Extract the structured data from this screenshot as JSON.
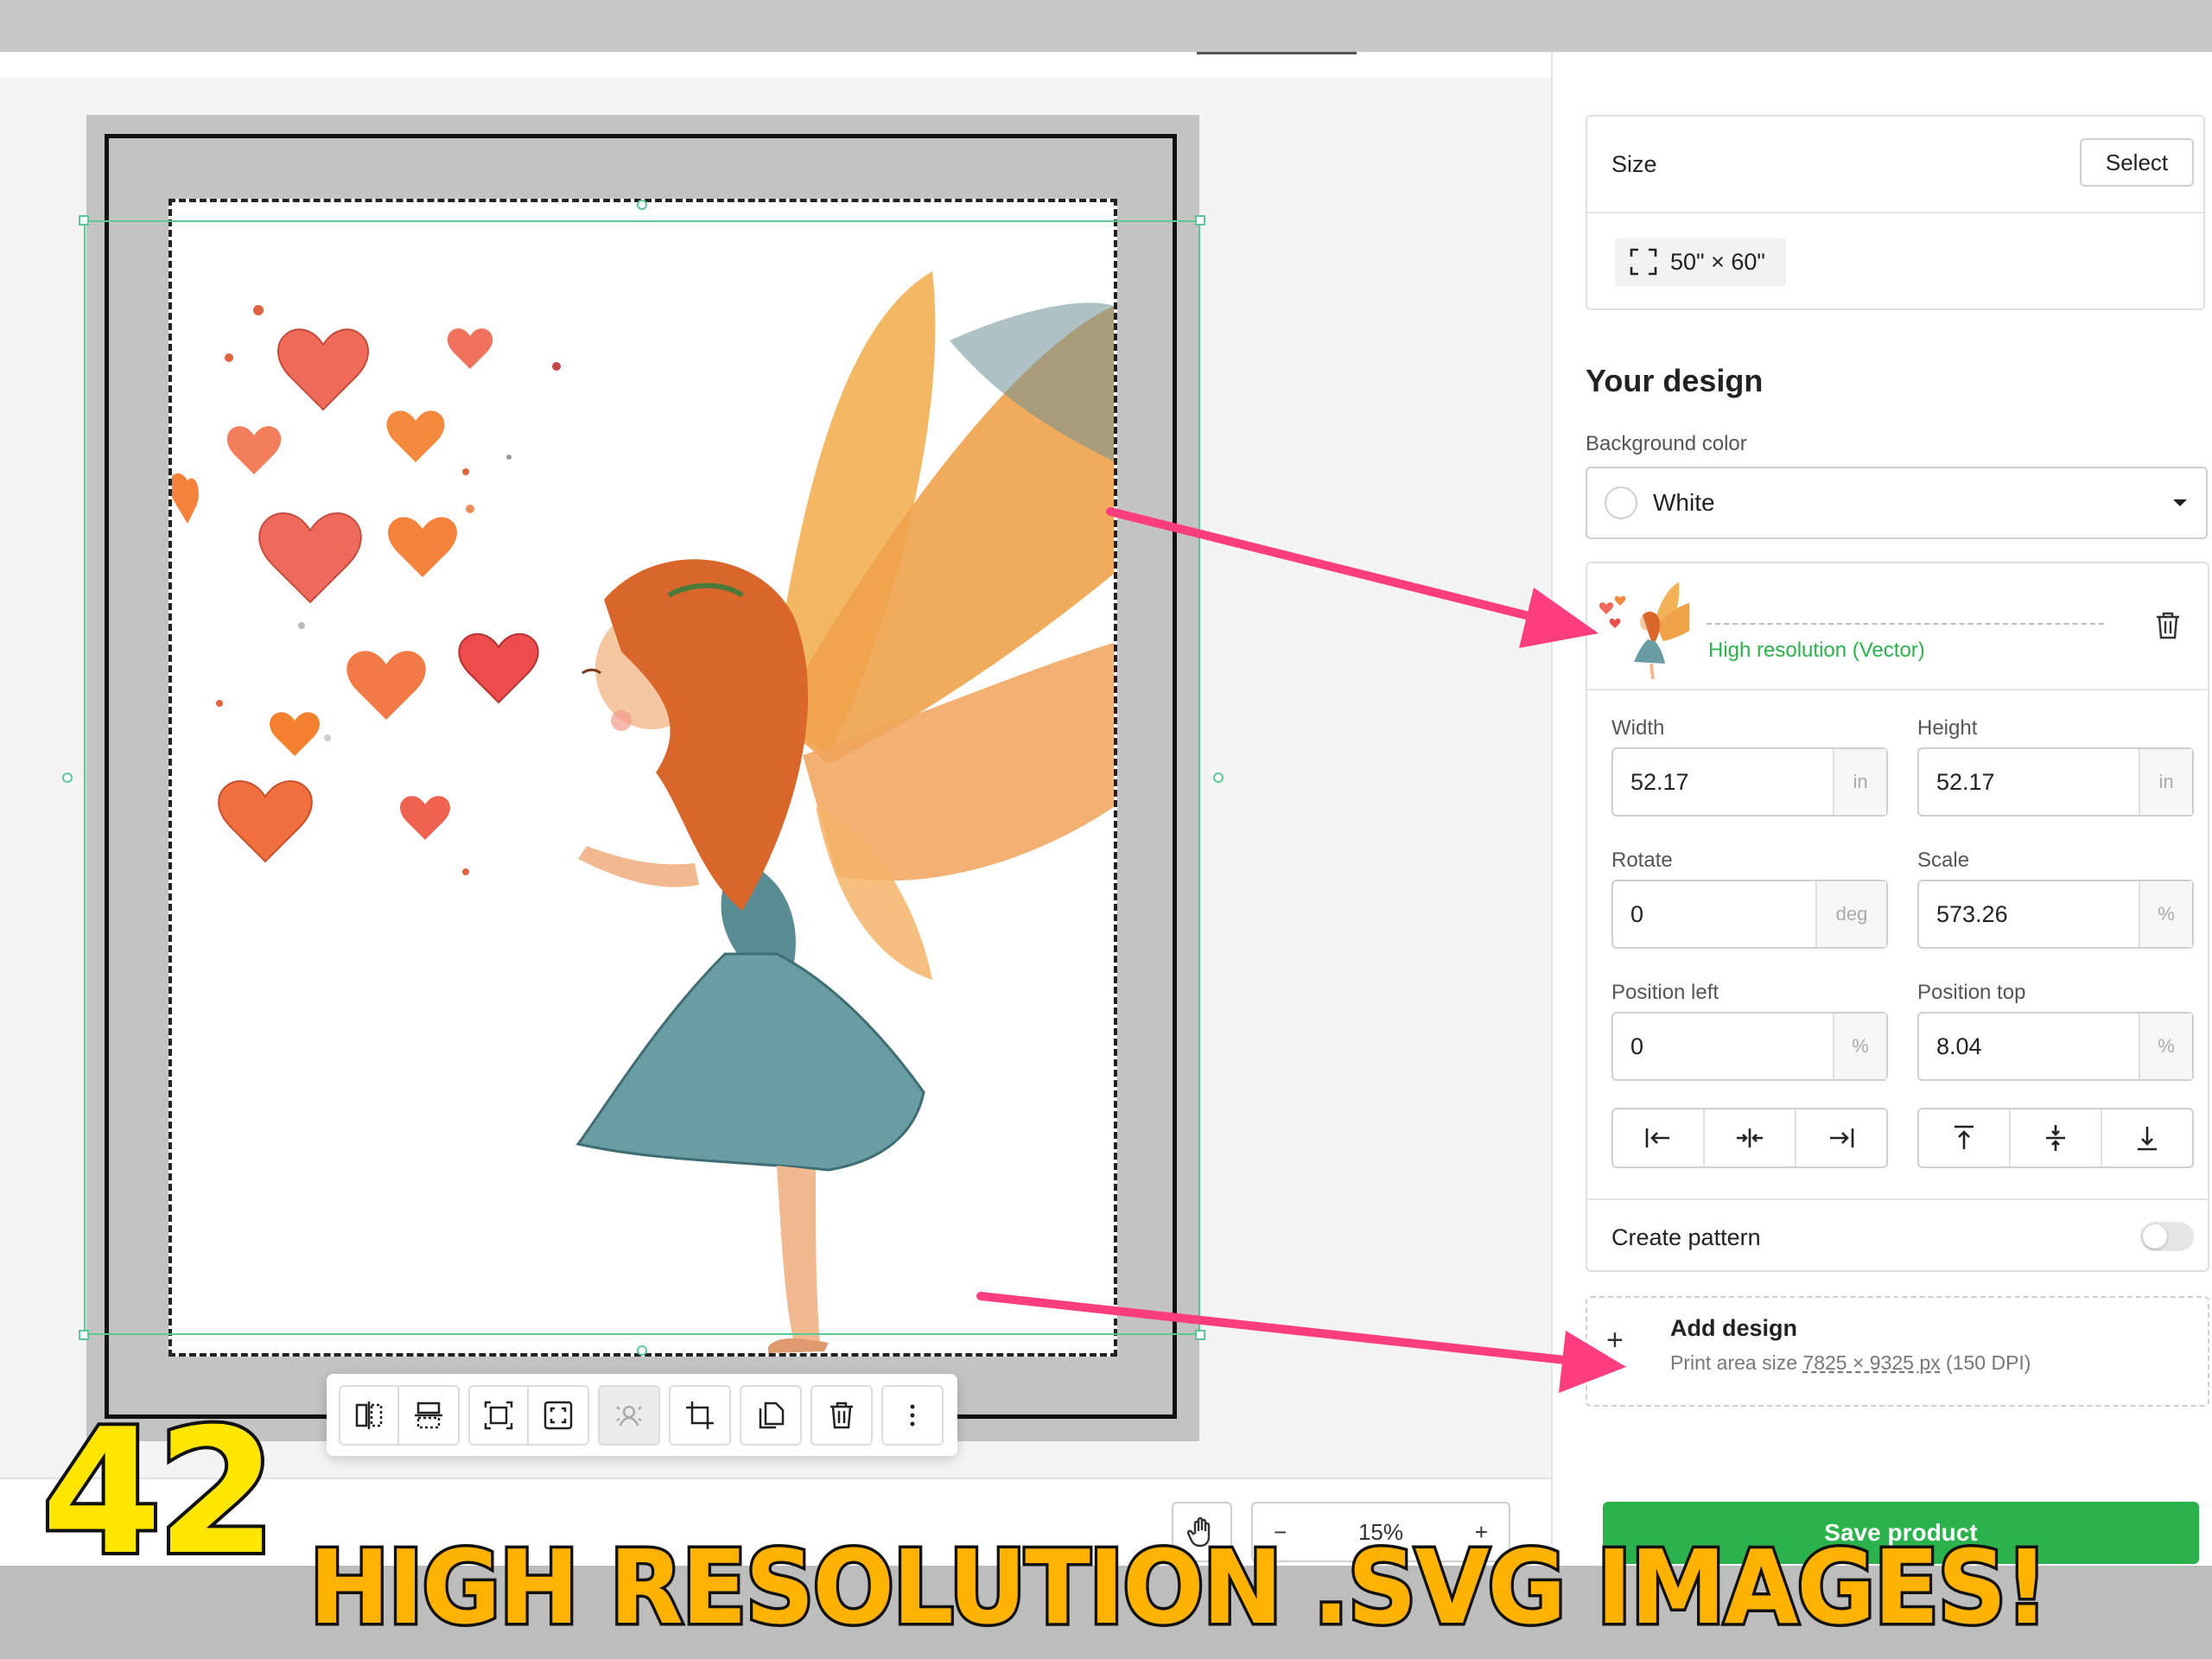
{
  "panel": {
    "size": {
      "label": "Size",
      "select_label": "Select",
      "value": "50\" × 60\""
    },
    "your_design_title": "Your design",
    "background": {
      "label": "Background color",
      "value": "White"
    },
    "layer": {
      "quality": "High resolution (Vector)"
    },
    "width": {
      "label": "Width",
      "value": "52.17",
      "unit": "in"
    },
    "height": {
      "label": "Height",
      "value": "52.17",
      "unit": "in"
    },
    "rotate": {
      "label": "Rotate",
      "value": "0",
      "unit": "deg"
    },
    "scale": {
      "label": "Scale",
      "value": "573.26",
      "unit": "%"
    },
    "position_left": {
      "label": "Position left",
      "value": "0",
      "unit": "%"
    },
    "position_top": {
      "label": "Position top",
      "value": "8.04",
      "unit": "%"
    },
    "create_pattern": {
      "label": "Create pattern",
      "enabled": false
    },
    "add_design": {
      "title": "Add design",
      "print_area_prefix": "Print area size",
      "print_area_size": "7825 × 9325 px",
      "print_area_dpi": "(150 DPI)"
    },
    "save_label": "Save product"
  },
  "zoom": {
    "minus": "−",
    "value": "15%",
    "plus": "+"
  },
  "toolbar_icons": [
    "flip-horizontal-icon",
    "flip-vertical-icon",
    "fit-icon",
    "fill-icon",
    "remove-background-icon",
    "crop-icon",
    "duplicate-icon",
    "trash-icon",
    "more-icon"
  ],
  "banner": {
    "number": "42",
    "text": "HIGH RESOLUTION .SVG IMAGES!"
  },
  "colors": {
    "accent_green": "#2bb24c",
    "selection_green": "#5cc995",
    "arrow_pink": "#ff3d7f",
    "banner_yellow": "#ffe600",
    "banner_orange": "#ffb300"
  }
}
